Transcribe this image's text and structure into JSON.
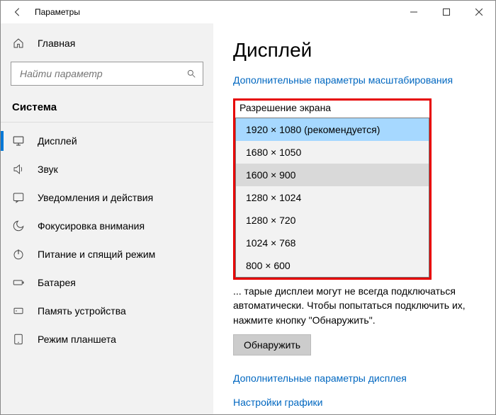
{
  "titlebar": {
    "title": "Параметры"
  },
  "sidebar": {
    "home": "Главная",
    "search_placeholder": "Найти параметр",
    "category": "Система",
    "items": [
      {
        "id": "display",
        "label": "Дисплей"
      },
      {
        "id": "sound",
        "label": "Звук"
      },
      {
        "id": "notif",
        "label": "Уведомления и действия"
      },
      {
        "id": "focus",
        "label": "Фокусировка внимания"
      },
      {
        "id": "power",
        "label": "Питание и спящий режим"
      },
      {
        "id": "battery",
        "label": "Батарея"
      },
      {
        "id": "storage",
        "label": "Память устройства"
      },
      {
        "id": "tablet",
        "label": "Режим планшета"
      }
    ]
  },
  "content": {
    "heading": "Дисплей",
    "scaling_link": "Дополнительные параметры масштабирования",
    "resolution_label": "Разрешение экрана",
    "resolutions": [
      "1920 × 1080 (рекомендуется)",
      "1680 × 1050",
      "1600 × 900",
      "1280 × 1024",
      "1280 × 720",
      "1024 × 768",
      "800 × 600"
    ],
    "detect_text": "... тарые дисплеи могут не всегда подключаться автоматически. Чтобы попытаться подключить их, нажмите кнопку \"Обнаружить\".",
    "detect_button": "Обнаружить",
    "adv_display_link": "Дополнительные параметры дисплея",
    "graphics_link": "Настройки графики"
  }
}
